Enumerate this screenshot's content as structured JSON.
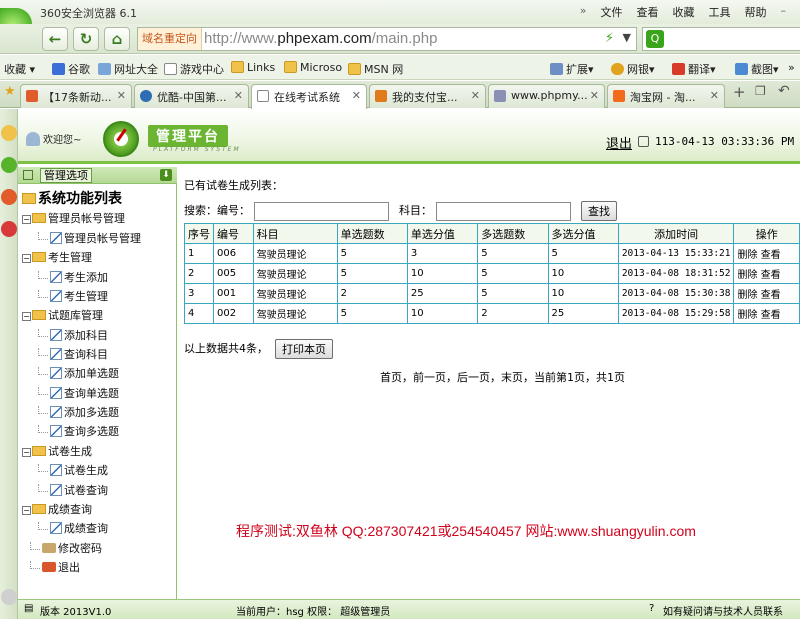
{
  "browser": {
    "app_title": "360安全浏览器 6.1",
    "menu": [
      "文件",
      "查看",
      "收藏",
      "工具",
      "帮助"
    ],
    "address_tag": "域名重定向",
    "url_prefix": "http://www.",
    "url_host": "phpexam.com",
    "url_path": "/main.php",
    "bookmarks_left": [
      "收藏",
      "谷歌",
      "网址大全",
      "游戏中心",
      "Links",
      "Microso",
      "MSN 网"
    ],
    "bookmarks_right": [
      "扩展",
      "网银",
      "翻译",
      "截图"
    ],
    "tabs": [
      {
        "label": "【17条新动..."
      },
      {
        "label": "优酷-中国第..."
      },
      {
        "label": "在线考试系统"
      },
      {
        "label": "我的支付宝..."
      },
      {
        "label": "www.phpmy..."
      },
      {
        "label": "淘宝网 - 淘..."
      }
    ]
  },
  "header": {
    "welcome": "欢迎您~",
    "platform_title": "管理平台",
    "platform_subtitle": "PLATFORM SYSTEM",
    "logout": "退出",
    "datetime": "113-04-13 03:33:36 PM"
  },
  "sidebar": {
    "head_label": "管理选项",
    "tree_title": "系统功能列表",
    "groups": [
      {
        "label": "管理员帐号管理",
        "items": [
          "管理员帐号管理"
        ]
      },
      {
        "label": "考生管理",
        "items": [
          "考生添加",
          "考生管理"
        ]
      },
      {
        "label": "试题库管理",
        "items": [
          "添加科目",
          "查询科目",
          "添加单选题",
          "查询单选题",
          "添加多选题",
          "查询多选题"
        ]
      },
      {
        "label": "试卷生成",
        "items": [
          "试卷生成",
          "试卷查询"
        ]
      },
      {
        "label": "成绩查询",
        "items": [
          "成绩查询"
        ]
      }
    ],
    "extra": [
      "修改密码",
      "退出"
    ]
  },
  "main": {
    "caption": "已有试卷生成列表：",
    "search_label": "搜索：编号：",
    "subject_label": "科目：",
    "search_button": "查找",
    "columns": [
      "序号",
      "编号",
      "科目",
      "单选题数",
      "单选分值",
      "多选题数",
      "多选分值",
      "添加时间",
      "操作"
    ],
    "rows": [
      [
        "1",
        "006",
        "驾驶员理论",
        "5",
        "3",
        "5",
        "5",
        "2013-04-13 15:33:21",
        "删除 查看"
      ],
      [
        "2",
        "005",
        "驾驶员理论",
        "5",
        "10",
        "5",
        "10",
        "2013-04-08 18:31:52",
        "删除 查看"
      ],
      [
        "3",
        "001",
        "驾驶员理论",
        "2",
        "25",
        "5",
        "10",
        "2013-04-08 15:30:38",
        "删除 查看"
      ],
      [
        "4",
        "002",
        "驾驶员理论",
        "5",
        "10",
        "2",
        "25",
        "2013-04-08 15:29:58",
        "删除 查看"
      ]
    ],
    "total_text": "以上数据共4条，",
    "print_button": "打印本页",
    "pager": "首页，前一页，后一页，末页，当前第1页，共1页",
    "watermark": "程序测试:双鱼林 QQ:287307421或254540457 网站:www.shuangyulin.com"
  },
  "status": {
    "version": "版本 2013V1.0",
    "current_user": "当前用户：hsg 权限：  超级管理员",
    "help": "如有疑问请与技术人员联系"
  }
}
